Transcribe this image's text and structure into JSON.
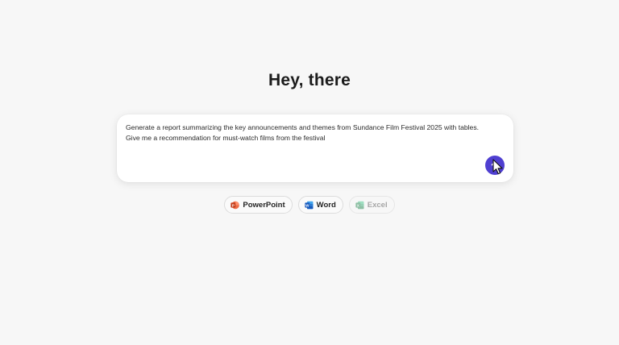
{
  "greeting": "Hey, there",
  "prompt": {
    "lines": [
      "Generate a report summarizing the key announcements and themes from Sundance Film Festival 2025 with tables.",
      "Give me a recommendation for must-watch films from the festival"
    ],
    "send_icon": "send-arrow-icon"
  },
  "colors": {
    "background": "#f7f7f7",
    "accent": "#4f3fd1",
    "powerpoint": "#c43e1c",
    "word": "#185abd",
    "excel": "#107c41"
  },
  "chips": [
    {
      "label": "PowerPoint",
      "icon": "powerpoint-icon",
      "enabled": true
    },
    {
      "label": "Word",
      "icon": "word-icon",
      "enabled": true
    },
    {
      "label": "Excel",
      "icon": "excel-icon",
      "enabled": false
    }
  ]
}
